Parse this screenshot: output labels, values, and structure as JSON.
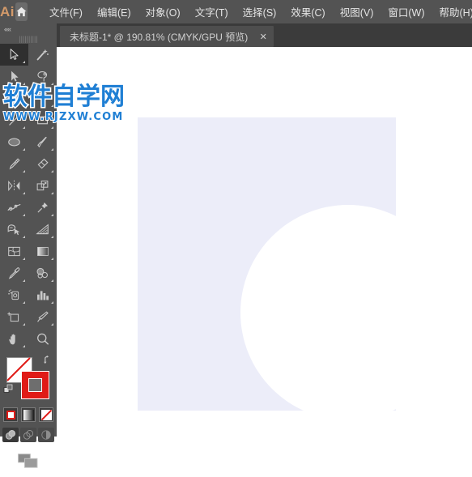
{
  "app": {
    "name": "Ai",
    "logo_color": "#d39a6a"
  },
  "menubar": {
    "home_icon": "home-icon",
    "items": [
      {
        "label": "文件(F)",
        "name": "menu-file"
      },
      {
        "label": "编辑(E)",
        "name": "menu-edit"
      },
      {
        "label": "对象(O)",
        "name": "menu-object"
      },
      {
        "label": "文字(T)",
        "name": "menu-type"
      },
      {
        "label": "选择(S)",
        "name": "menu-select"
      },
      {
        "label": "效果(C)",
        "name": "menu-effect"
      },
      {
        "label": "视图(V)",
        "name": "menu-view"
      },
      {
        "label": "窗口(W)",
        "name": "menu-window"
      },
      {
        "label": "帮助(H)",
        "name": "menu-help"
      }
    ]
  },
  "tabbar": {
    "tab_title": "未标题-1* @ 190.81% (CMYK/GPU 预览)",
    "close_label": "✕"
  },
  "toolbar": {
    "collapse_label": "««",
    "grip_label": "||||||||||",
    "tools": [
      {
        "name": "selection-tool",
        "label": "选择工具",
        "active": true
      },
      {
        "name": "magic-wand-tool",
        "label": "魔棒工具",
        "active": false
      },
      {
        "name": "direct-selection-tool",
        "label": "直接选择工具",
        "active": false
      },
      {
        "name": "lasso-tool",
        "label": "套索工具",
        "active": false
      },
      {
        "name": "pen-tool",
        "label": "钢笔工具",
        "active": false
      },
      {
        "name": "type-tool",
        "label": "文字工具",
        "active": false
      },
      {
        "name": "line-segment-tool",
        "label": "直线段工具",
        "active": false
      },
      {
        "name": "rectangle-tool",
        "label": "矩形工具",
        "active": false
      },
      {
        "name": "ellipse-tool",
        "label": "椭圆工具",
        "active": false
      },
      {
        "name": "paintbrush-tool",
        "label": "画笔工具",
        "active": false
      },
      {
        "name": "pencil-tool",
        "label": "铅笔工具",
        "active": false
      },
      {
        "name": "eraser-tool",
        "label": "橡皮擦工具",
        "active": false
      },
      {
        "name": "rotate-reflect-tool",
        "label": "旋转镜像工具",
        "active": false
      },
      {
        "name": "scale-tool",
        "label": "比例缩放工具",
        "active": false
      },
      {
        "name": "width-warp-tool",
        "label": "宽度变形工具",
        "active": false
      },
      {
        "name": "free-transform-tool",
        "label": "自由变换工具",
        "active": false
      },
      {
        "name": "shape-builder-tool",
        "label": "形状生成器工具",
        "active": false
      },
      {
        "name": "perspective-grid-tool",
        "label": "透视网格工具",
        "active": false
      },
      {
        "name": "mesh-tool",
        "label": "网格工具",
        "active": false
      },
      {
        "name": "gradient-tool",
        "label": "渐变工具",
        "active": false
      },
      {
        "name": "eyedropper-tool",
        "label": "吸管工具",
        "active": false
      },
      {
        "name": "blend-tool",
        "label": "混合工具",
        "active": false
      },
      {
        "name": "symbol-sprayer-tool",
        "label": "符号喷枪工具",
        "active": false
      },
      {
        "name": "column-graph-tool",
        "label": "柱形图工具",
        "active": false
      },
      {
        "name": "artboard-tool",
        "label": "画板工具",
        "active": false
      },
      {
        "name": "slice-tool",
        "label": "切片工具",
        "active": false
      },
      {
        "name": "hand-tool",
        "label": "抓手工具",
        "active": false
      },
      {
        "name": "zoom-tool",
        "label": "缩放工具",
        "active": false
      }
    ],
    "fill": {
      "name": "fill-swatch",
      "value": "无",
      "color": "#ffffff",
      "is_none": true
    },
    "stroke": {
      "name": "stroke-swatch",
      "value": "红色",
      "color": "#e01b17"
    },
    "swap_icon": "swap-fill-stroke-icon",
    "default_icon": "default-fill-stroke-icon",
    "paint_modes": [
      {
        "name": "color-mode-button",
        "label": "颜色",
        "selected": true
      },
      {
        "name": "gradient-mode-button",
        "label": "渐变",
        "selected": false
      },
      {
        "name": "none-mode-button",
        "label": "无",
        "selected": false
      }
    ],
    "draw_modes": [
      {
        "name": "draw-normal-button",
        "label": "正常绘图",
        "selected": true
      },
      {
        "name": "draw-behind-button",
        "label": "背面绘图",
        "selected": false
      },
      {
        "name": "draw-inside-button",
        "label": "内部绘图",
        "selected": false
      }
    ],
    "screen_mode": {
      "name": "screen-mode-button",
      "label": "更改屏幕模式"
    }
  },
  "canvas": {
    "background_color": "#ffffff",
    "artboard": {
      "name": "artboard",
      "fill_color": "#ecedf9",
      "label": "画板 1"
    },
    "shape": {
      "name": "ellipse-shape",
      "type": "circle",
      "fill_color": "#ffffff",
      "label": "白色圆形"
    }
  },
  "watermark": {
    "cn_text": "软件自学网",
    "url_text": "WWW.RJZXW.COM",
    "color": "#1f7fd4"
  }
}
